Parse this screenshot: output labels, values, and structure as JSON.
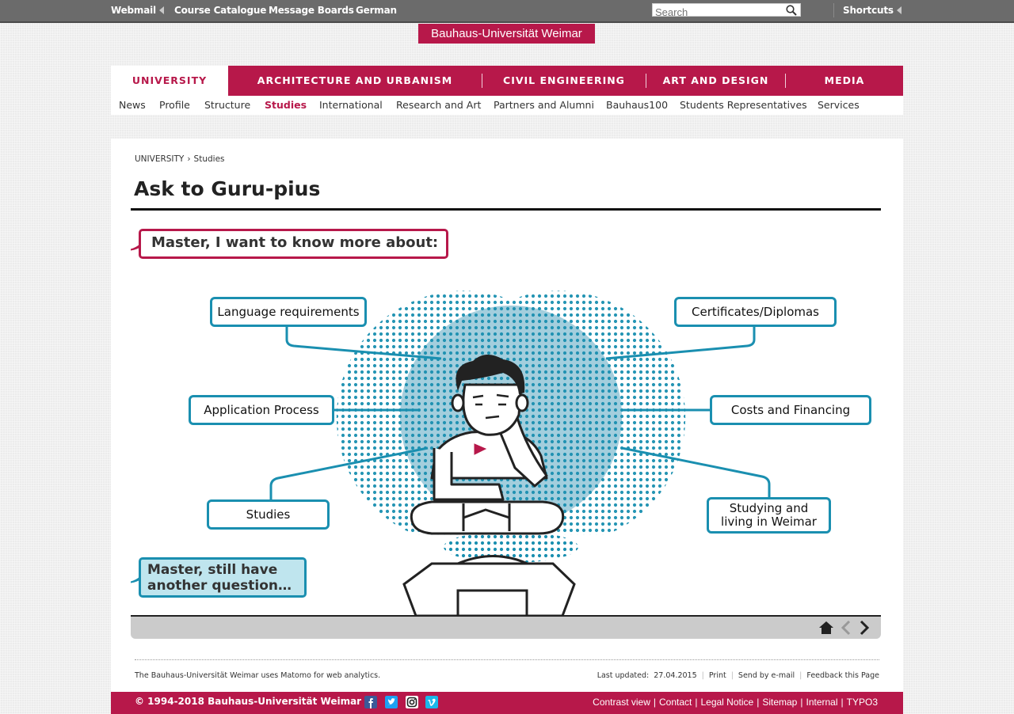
{
  "topbar": {
    "links": [
      "Webmail",
      "Course Catalogue",
      "Message Boards",
      "German"
    ],
    "search_placeholder": "Search",
    "shortcuts": "Shortcuts"
  },
  "logo": "Bauhaus-Universität Weimar",
  "mainnav": [
    "UNIVERSITY",
    "ARCHITECTURE AND URBANISM",
    "CIVIL ENGINEERING",
    "ART AND DESIGN",
    "MEDIA"
  ],
  "subnav": [
    "News",
    "Profile",
    "Structure",
    "Studies",
    "International",
    "Research and Art",
    "Partners and Alumni",
    "Bauhaus100",
    "Students Representatives",
    "Services"
  ],
  "breadcrumb": [
    "UNIVERSITY",
    "›",
    "Studies"
  ],
  "page_title": "Ask to Guru-pius",
  "question": "Master, I want to know more about:",
  "question2": [
    "Master, still have",
    "another question…"
  ],
  "topics": {
    "language": "Language requirements",
    "application": "Application Process",
    "studies": "Studies",
    "certificates": "Certificates/Diplomas",
    "costs": "Costs and Financing",
    "living": [
      "Studying and",
      "living in Weimar"
    ]
  },
  "info": {
    "matomo": "The Bauhaus-Universität Weimar uses Matomo for web analytics.",
    "last_updated_label": "Last updated:",
    "last_updated": "27.04.2015",
    "print": "Print",
    "send": "Send by e-mail",
    "feedback": "Feedback this Page"
  },
  "footer": {
    "copyright": "© 1994-2018 Bauhaus-Universität Weimar",
    "links": [
      "Contrast view",
      "Contact",
      "Legal Notice",
      "Sitemap",
      "Internal",
      "TYPO3"
    ]
  },
  "colors": {
    "brand": "#b7184a",
    "accent": "#1a8fb0",
    "accent_light": "#bfe5ee"
  }
}
